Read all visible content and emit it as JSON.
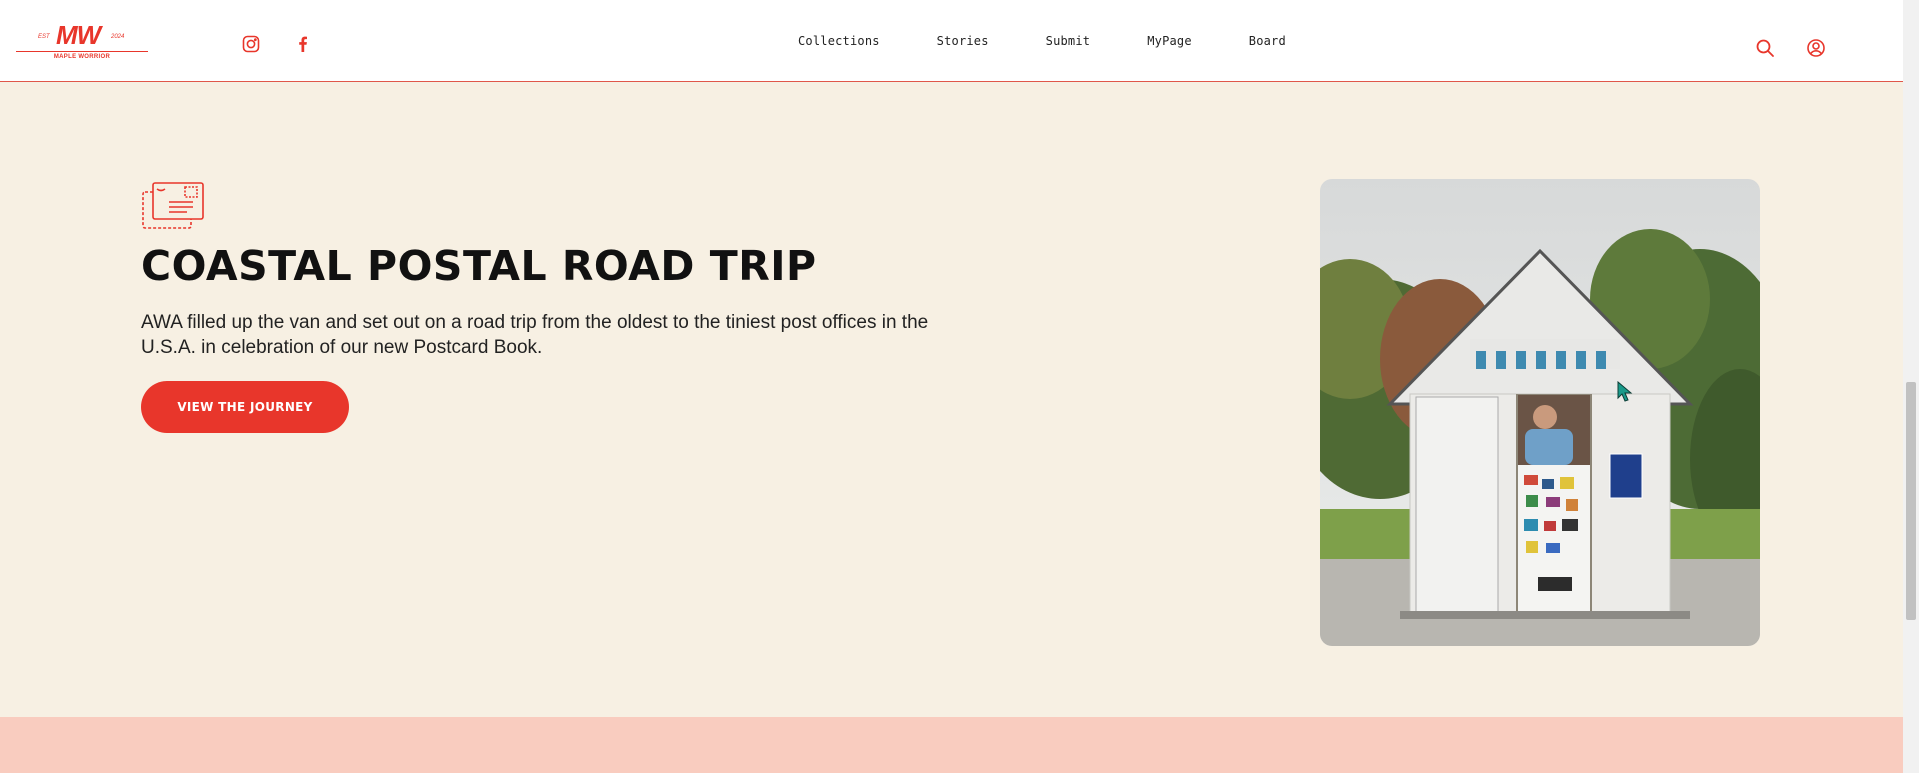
{
  "header": {
    "logo": {
      "mark": "MW",
      "est": "EST",
      "year": "2024",
      "subtitle": "MAPLE WORRIOR"
    },
    "social": [
      "instagram-icon",
      "facebook-icon"
    ],
    "nav": [
      "Collections",
      "Stories",
      "Submit",
      "MyPage",
      "Board"
    ],
    "icons": [
      "search-icon",
      "user-icon"
    ]
  },
  "hero": {
    "icon": "postcard-icon",
    "title": "COASTAL POSTAL ROAD TRIP",
    "description": "AWA filled up the van and set out on a road trip from the oldest to the tiniest post offices in the U.S.A. in celebration of our new Postcard Book.",
    "cta_label": "VIEW THE JOURNEY"
  },
  "colors": {
    "accent": "#e8362b",
    "hero_bg": "#f7f0e3",
    "band_bg": "#f9ccbf"
  }
}
